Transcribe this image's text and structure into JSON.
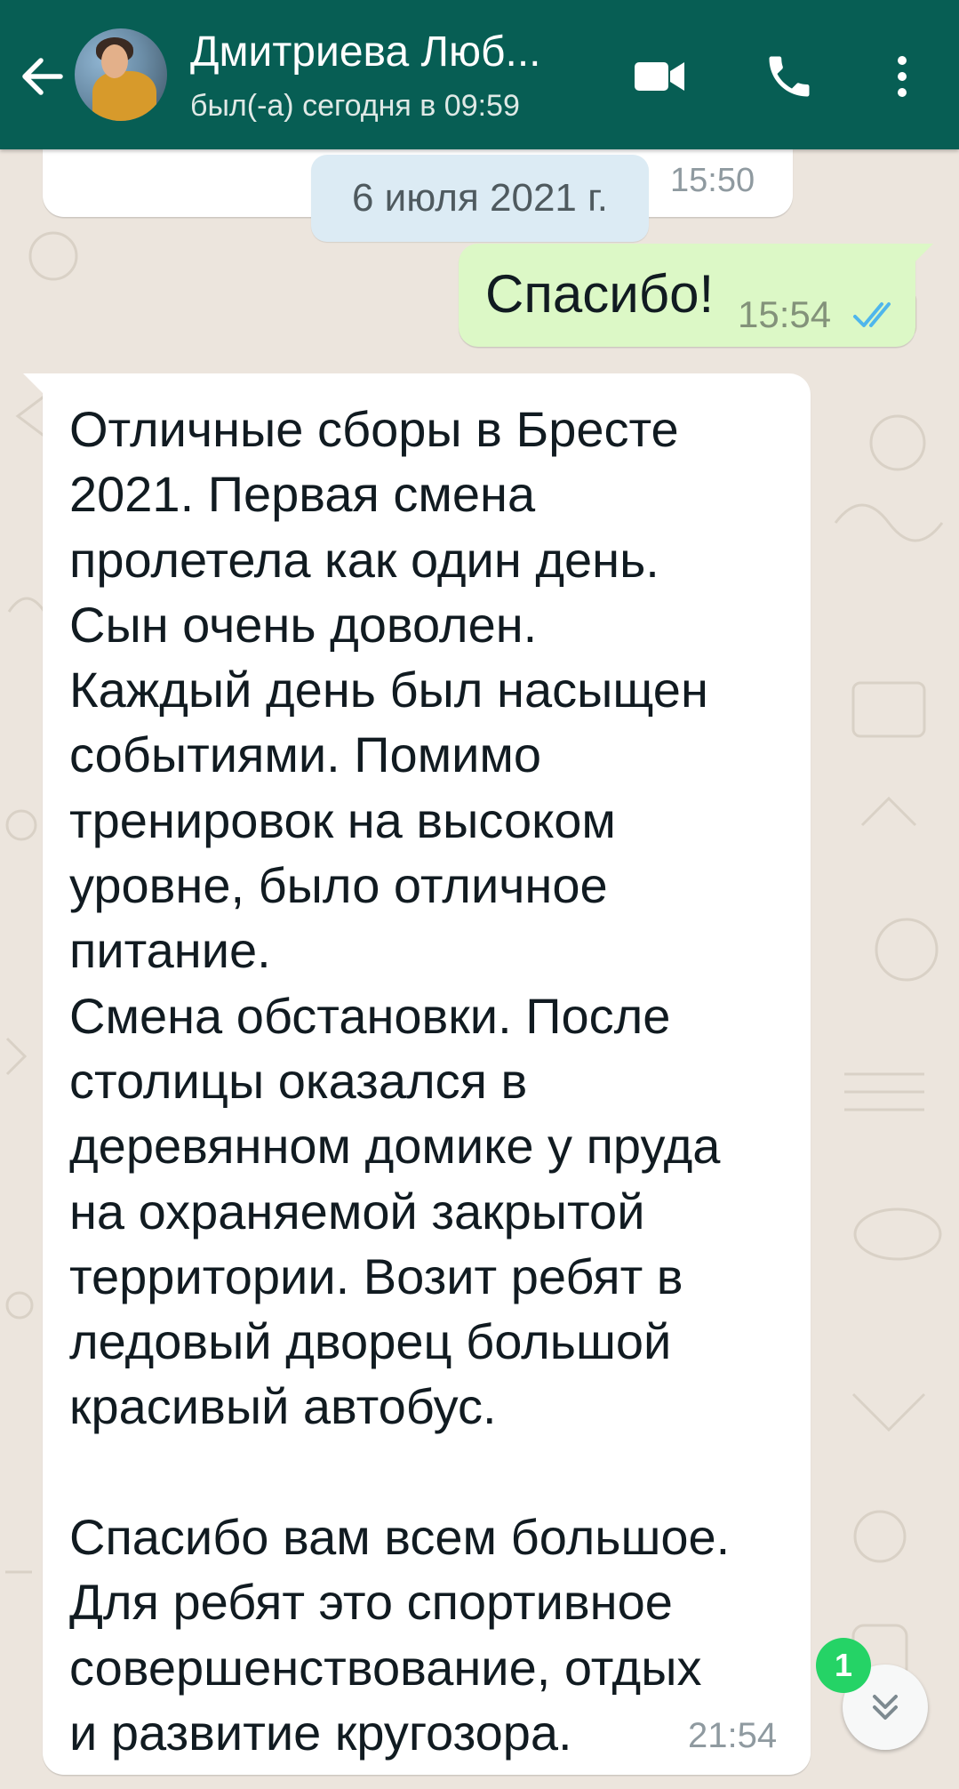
{
  "header": {
    "contact_name": "Дмитриева Люб...",
    "status": "был(-а) сегодня в 09:59",
    "back_icon": "arrow-left-icon",
    "video_icon": "video-camera-icon",
    "phone_icon": "phone-icon",
    "menu_icon": "more-vertical-icon",
    "background_color": "#075e54"
  },
  "messages": {
    "prev_incoming_time": "15:50",
    "date_separator": "6 июля 2021 г.",
    "outgoing": {
      "text": "Спасибо!",
      "time": "15:54",
      "status_icon": "double-check-read-icon"
    },
    "incoming": {
      "text": "Отличные сборы в Бресте\n2021. Первая смена\nпролетела как один день.\nСын очень доволен.\nКаждый день был насыщен\nсобытиями. Помимо\nтренировок на высоком\nуровне, было отличное\nпитание.\nСмена обстановки. После\nстолицы оказался в\nдеревянном домике у пруда\nна охраняемой закрытой\nтерритории. Возит ребят в\nледовый дворец большой\nкрасивый автобус.\n\nСпасибо вам всем большое.\nДля ребят это спортивное\nсовершенствование, отдых\nи развитие кругозора.",
      "time": "21:54"
    }
  },
  "scroll_button": {
    "unread_count": "1",
    "icon": "double-chevron-down-icon"
  },
  "colors": {
    "outgoing_bubble": "#dcf8c6",
    "incoming_bubble": "#ffffff",
    "date_chip": "#dcebf4",
    "badge": "#25d366",
    "read_ticks": "#4fb6ec"
  }
}
